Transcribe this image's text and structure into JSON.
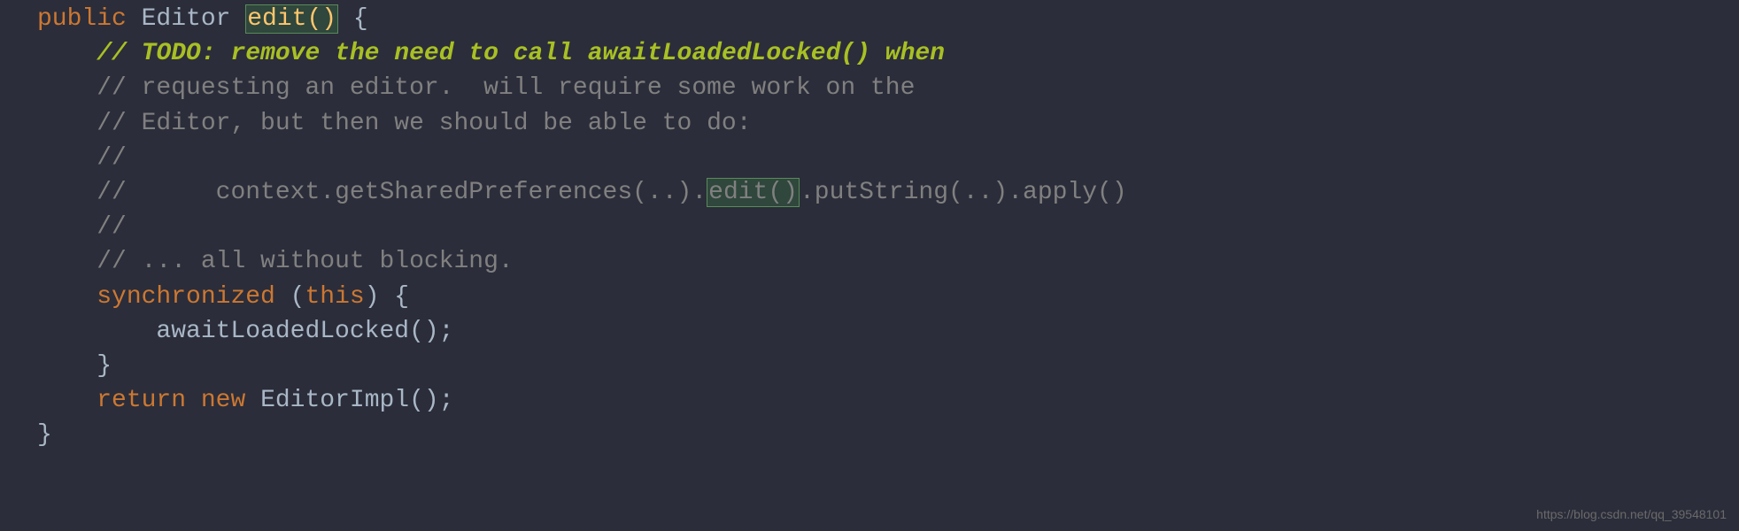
{
  "code": {
    "line1_kw": "public",
    "line1_type": " Editor ",
    "line1_method": "edit()",
    "line1_brace": " {",
    "line2_indent": "    ",
    "line2_slash": "// ",
    "line2_todo": "TODO: remove the need to call awaitLoadedLocked() when",
    "line3_indent": "    ",
    "line3_comment": "// requesting an editor.  will require some work on the",
    "line4_indent": "    ",
    "line4_comment": "// Editor, but then we should be able to do:",
    "line5_indent": "    ",
    "line5_comment": "//",
    "line6_indent": "    ",
    "line6_prefix": "//      context.getSharedPreferences(..).",
    "line6_highlight": "edit()",
    "line6_suffix": ".putString(..).apply()",
    "line7_indent": "    ",
    "line7_comment": "//",
    "line8_indent": "    ",
    "line8_comment": "// ... all without blocking.",
    "line9_indent": "    ",
    "line9_sync": "synchronized",
    "line9_paren_open": " (",
    "line9_this": "this",
    "line9_paren_close": ") {",
    "line10_indent": "        ",
    "line10_call": "awaitLoadedLocked();",
    "line11_indent": "    ",
    "line11_brace": "}",
    "line12_blank": "",
    "line13_indent": "    ",
    "line13_return": "return",
    "line13_new": " new",
    "line13_ctor": " EditorImpl();",
    "line14_brace": "}"
  },
  "watermark": "https://blog.csdn.net/qq_39548101"
}
